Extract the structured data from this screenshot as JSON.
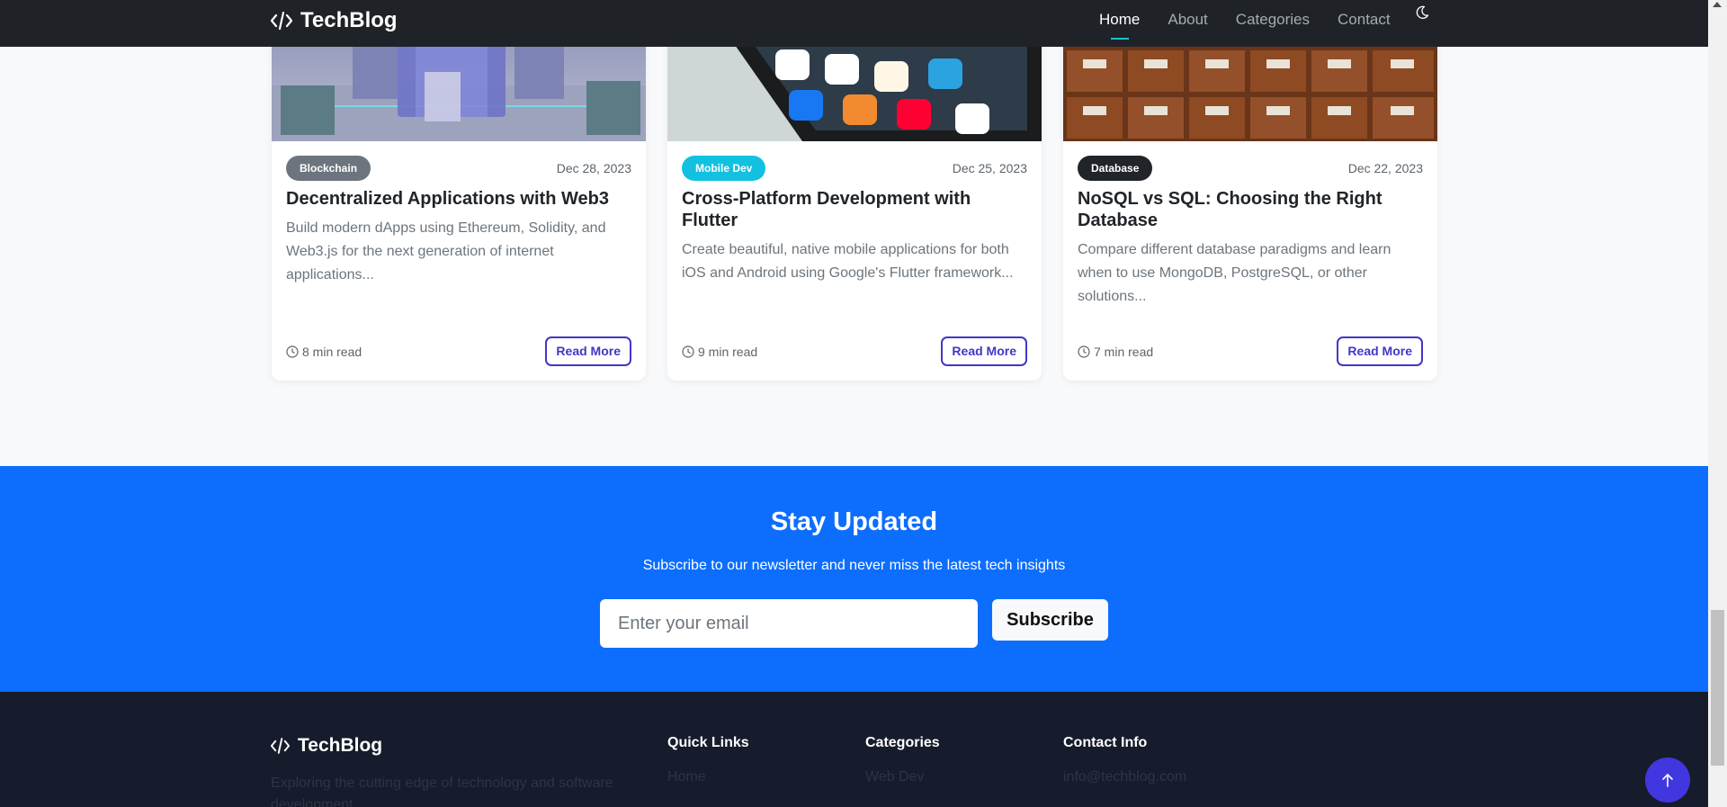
{
  "navbar": {
    "brand": "TechBlog",
    "links": [
      "Home",
      "About",
      "Categories",
      "Contact"
    ],
    "active": "Home",
    "theme_toggle_icon": "moon-icon"
  },
  "cards": [
    {
      "category": "Blockchain",
      "category_color": "#6c757d",
      "date": "Dec 28, 2023",
      "title": "Decentralized Applications with Web3",
      "excerpt": "Build modern dApps using Ethereum, Solidity, and Web3.js for the next generation of internet applications...",
      "read_time": "8 min read",
      "read_more": "Read More",
      "image": "blockchain-cubes-image"
    },
    {
      "category": "Mobile Dev",
      "category_color": "#12c1e0",
      "date": "Dec 25, 2023",
      "title": "Cross-Platform Development with Flutter",
      "excerpt": "Create beautiful, native mobile applications for both iOS and Android using Google's Flutter framework...",
      "read_time": "9 min read",
      "read_more": "Read More",
      "image": "smartphone-apps-image"
    },
    {
      "category": "Database",
      "category_color": "#212529",
      "date": "Dec 22, 2023",
      "title": "NoSQL vs SQL: Choosing the Right Database",
      "excerpt": "Compare different database paradigms and learn when to use MongoDB, PostgreSQL, or other solutions...",
      "read_time": "7 min read",
      "read_more": "Read More",
      "image": "card-catalog-drawers-image"
    }
  ],
  "newsletter": {
    "title": "Stay Updated",
    "subtitle": "Subscribe to our newsletter and never miss the latest tech insights",
    "email_placeholder": "Enter your email",
    "button": "Subscribe",
    "background": "#0d6efd"
  },
  "footer": {
    "brand": "TechBlog",
    "description": "Exploring the cutting edge of technology and software development",
    "columns": [
      {
        "heading": "Quick Links",
        "first_item": "Home"
      },
      {
        "heading": "Categories",
        "first_item": "Web Dev"
      },
      {
        "heading": "Contact Info",
        "first_item": "info@techblog.com"
      }
    ]
  },
  "back_to_top_icon": "arrow-up-icon"
}
